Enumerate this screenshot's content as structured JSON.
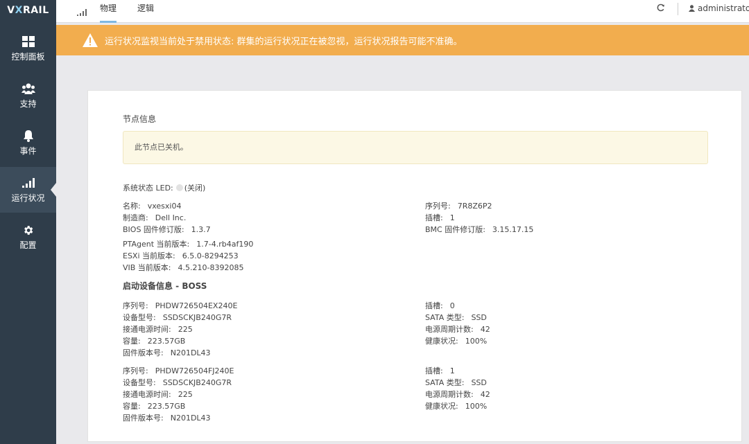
{
  "app": {
    "logo_prefix": "V",
    "logo_x": "X",
    "logo_suffix": "RAIL"
  },
  "sidebar": {
    "items": [
      {
        "label": "控制面板",
        "icon": "dashboard-icon"
      },
      {
        "label": "支持",
        "icon": "users-icon"
      },
      {
        "label": "事件",
        "icon": "bell-icon"
      },
      {
        "label": "运行状况",
        "icon": "signal-icon"
      },
      {
        "label": "配置",
        "icon": "gear-icon"
      }
    ]
  },
  "topbar": {
    "tabs": [
      {
        "label": "物理"
      },
      {
        "label": "逻辑"
      }
    ],
    "user": "administrator"
  },
  "banner": {
    "text": "运行状况监视当前处于禁用状态: 群集的运行状况正在被忽视，运行状况报告可能不准确。"
  },
  "node": {
    "title": "节点信息",
    "notice": "此节点已关机。",
    "led_label": "系统状态 LED:",
    "led_state": "(关闭)",
    "left": [
      {
        "k": "名称:",
        "v": "vxesxi04"
      },
      {
        "k": "制造商:",
        "v": "Dell Inc."
      },
      {
        "k": "BIOS 固件修订版:",
        "v": "1.3.7"
      }
    ],
    "right": [
      {
        "k": "序列号:",
        "v": "7R8Z6P2"
      },
      {
        "k": "插槽:",
        "v": "1"
      },
      {
        "k": "BMC 固件修订版:",
        "v": "3.15.17.15"
      }
    ],
    "versions": [
      {
        "k": "PTAgent 当前版本:",
        "v": "1.7-4.rb4af190"
      },
      {
        "k": "ESXi 当前版本:",
        "v": "6.5.0-8294253"
      },
      {
        "k": "VIB 当前版本:",
        "v": "4.5.210-8392085"
      }
    ]
  },
  "boot": {
    "title": "启动设备信息 - BOSS",
    "devices": [
      {
        "left": [
          {
            "k": "序列号:",
            "v": "PHDW726504EX240E"
          },
          {
            "k": "设备型号:",
            "v": "SSDSCKJB240G7R"
          },
          {
            "k": "接通电源时间:",
            "v": "225"
          },
          {
            "k": "容量:",
            "v": "223.57GB"
          },
          {
            "k": "固件版本号:",
            "v": "N201DL43"
          }
        ],
        "right": [
          {
            "k": "插槽:",
            "v": "0"
          },
          {
            "k": "SATA 类型:",
            "v": "SSD"
          },
          {
            "k": "电源周期计数:",
            "v": "42"
          },
          {
            "k": "健康状况:",
            "v": "100%"
          }
        ]
      },
      {
        "left": [
          {
            "k": "序列号:",
            "v": "PHDW726504FJ240E"
          },
          {
            "k": "设备型号:",
            "v": "SSDSCKJB240G7R"
          },
          {
            "k": "接通电源时间:",
            "v": "225"
          },
          {
            "k": "容量:",
            "v": "223.57GB"
          },
          {
            "k": "固件版本号:",
            "v": "N201DL43"
          }
        ],
        "right": [
          {
            "k": "插槽:",
            "v": "1"
          },
          {
            "k": "SATA 类型:",
            "v": "SSD"
          },
          {
            "k": "电源周期计数:",
            "v": "42"
          },
          {
            "k": "健康状况:",
            "v": "100%"
          }
        ]
      }
    ]
  },
  "colors": {
    "sidebar": "#2f3d4a",
    "banner": "#f2ad4e",
    "notice": "#fcf8e5",
    "tab_underline": "#7eb8e2"
  }
}
